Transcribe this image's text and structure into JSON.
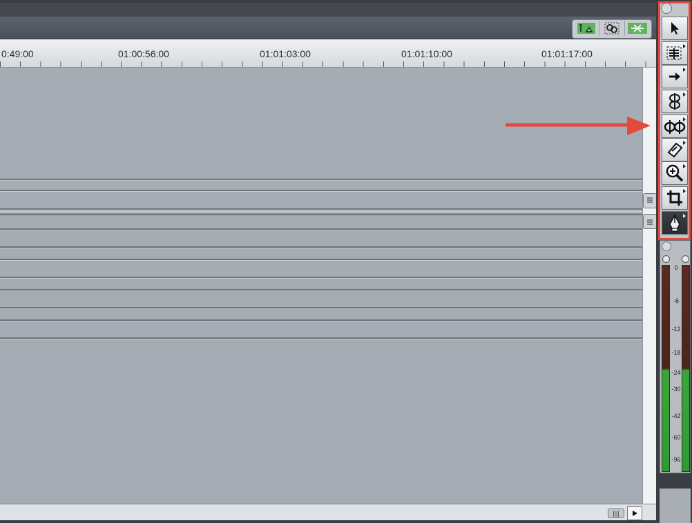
{
  "timeline": {
    "timecodes": [
      "0:49:00",
      "01:00:56:00",
      "01:01:03:00",
      "01:01:10:00",
      "01:01:17:00"
    ],
    "toggles": [
      "snapping-icon",
      "linking-icon",
      "track-height-icon"
    ]
  },
  "tool_palette": {
    "tools": [
      {
        "name": "selection-tool",
        "icon": "arrow-pointer-icon"
      },
      {
        "name": "edit-selection-tool",
        "icon": "edit-select-icon"
      },
      {
        "name": "track-select-tool",
        "icon": "track-forward-icon"
      },
      {
        "name": "roll-tool",
        "icon": "roll-edit-icon"
      },
      {
        "name": "slip-tool",
        "icon": "slip-edit-icon"
      },
      {
        "name": "razor-tool",
        "icon": "razor-blade-icon"
      },
      {
        "name": "zoom-tool",
        "icon": "zoom-in-icon"
      },
      {
        "name": "crop-tool",
        "icon": "crop-icon"
      },
      {
        "name": "pen-tool",
        "icon": "pen-icon"
      }
    ],
    "highlight_color": "#e5483c"
  },
  "audio_meter": {
    "scale": [
      "0",
      "-6",
      "-12",
      "-18",
      "-24",
      "-30",
      "-42",
      "-60",
      "-96"
    ],
    "level_color": "#33a83a",
    "peak_color": "#5a2a1f"
  },
  "annotation": {
    "arrow_color": "#e5483c"
  }
}
